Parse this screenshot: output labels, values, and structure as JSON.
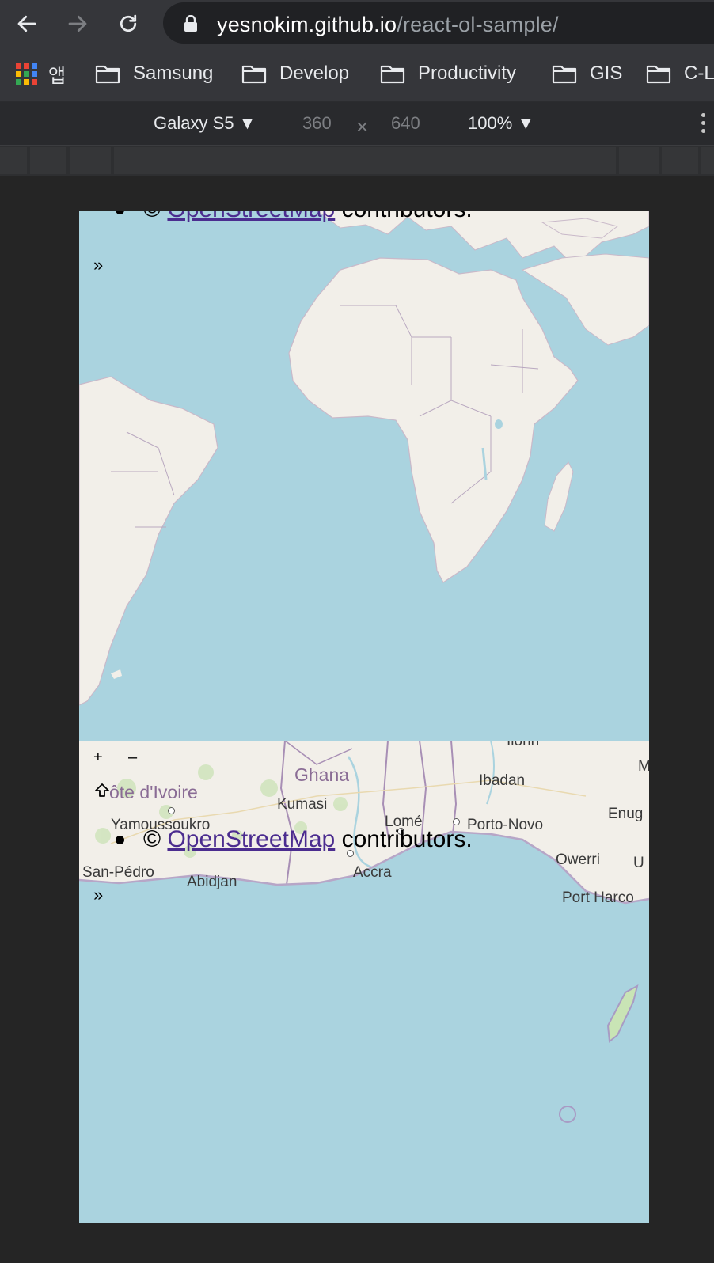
{
  "browser": {
    "url_host": "yesnokim.github.io",
    "url_path": "/react-ol-sample/",
    "bookmarks": [
      {
        "label": "앱",
        "icon": "apps-grid-icon"
      },
      {
        "label": "Samsung",
        "icon": "folder-icon"
      },
      {
        "label": "Develop",
        "icon": "folder-icon"
      },
      {
        "label": "Productivity",
        "icon": "folder-icon"
      },
      {
        "label": "GIS",
        "icon": "folder-icon"
      },
      {
        "label": "C-L",
        "icon": "folder-icon"
      }
    ]
  },
  "device_toolbar": {
    "device": "Galaxy S5 ▼",
    "width": "360",
    "times": "×",
    "height": "640",
    "zoom": "100% ▼"
  },
  "page": {
    "map1": {
      "attribution_prefix": "©",
      "attribution_link": "OpenStreetMap",
      "attribution_suffix": "contributors.",
      "toggle": "»"
    },
    "map2": {
      "zoom_in": "+",
      "zoom_out": "–",
      "attribution_prefix": "©",
      "attribution_link": "OpenStreetMap",
      "attribution_suffix": "contributors.",
      "toggle": "»",
      "places": {
        "ghana": "Ghana",
        "cote": "ôte d'Ivoire",
        "ibadan": "Ibadan",
        "kumasi": "Kumasi",
        "yamoussoukro": "Yamoussoukro",
        "lome": "Lomé",
        "porto_novo": "Porto-Novo",
        "enugu": "Enug",
        "m": "M",
        "owerri": "Owerri",
        "u": "U",
        "san_pedro": "San-Pédro",
        "abidjan": "Abidjan",
        "accra": "Accra",
        "port_harcourt": "Port Harco",
        "ilorin": "Ilorin"
      }
    }
  },
  "colors": {
    "water": "#aad3df",
    "land": "#f2efe9",
    "link": "#4b2c8f"
  }
}
